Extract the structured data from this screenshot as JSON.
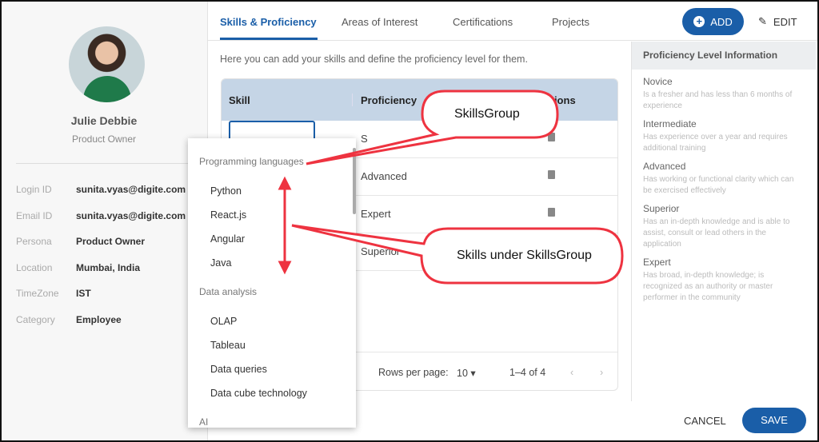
{
  "profile": {
    "name": "Julie Debbie",
    "role": "Product Owner",
    "info": [
      {
        "label": "Login ID",
        "value": "sunita.vyas@digite.com"
      },
      {
        "label": "Email ID",
        "value": "sunita.vyas@digite.com"
      },
      {
        "label": "Persona",
        "value": "Product Owner"
      },
      {
        "label": "Location",
        "value": "Mumbai, India"
      },
      {
        "label": "TimeZone",
        "value": "IST"
      },
      {
        "label": "Category",
        "value": "Employee"
      }
    ]
  },
  "tabs": [
    "Skills & Proficiency",
    "Areas of Interest",
    "Certifications",
    "Projects"
  ],
  "toolbar": {
    "add": "ADD",
    "edit": "EDIT"
  },
  "intro": "Here you can add your skills and define the proficiency level for them.",
  "table": {
    "headers": [
      "Skill",
      "Proficiency",
      "Actions"
    ],
    "rows": [
      {
        "proficiency": "S"
      },
      {
        "proficiency": "Advanced"
      },
      {
        "proficiency": "Expert"
      },
      {
        "proficiency": "Superior"
      }
    ],
    "footer": {
      "rows_label": "Rows per page:",
      "rows_value": "10",
      "range": "1–4 of 4"
    }
  },
  "dropdown": {
    "groups": [
      {
        "name": "Programming languages",
        "items": [
          "Python",
          "React.js",
          "Angular",
          "Java"
        ]
      },
      {
        "name": "Data analysis",
        "items": [
          "OLAP",
          "Tableau",
          "Data queries",
          "Data cube technology"
        ]
      },
      {
        "name": "AI",
        "items": []
      }
    ]
  },
  "info_panel": {
    "title": "Proficiency Level Information",
    "levels": [
      {
        "name": "Novice",
        "desc": "Is a fresher and has less than 6 months of experience"
      },
      {
        "name": "Intermediate",
        "desc": "Has experience over a year and requires additional training"
      },
      {
        "name": "Advanced",
        "desc": "Has working or functional clarity which can be exercised effectively"
      },
      {
        "name": "Superior",
        "desc": "Has an in-depth knowledge and is able to assist, consult or lead others in the application"
      },
      {
        "name": "Expert",
        "desc": "Has broad, in-depth knowledge; is recognized as an authority or master performer in the community"
      }
    ]
  },
  "footer": {
    "cancel": "CANCEL",
    "save": "SAVE"
  },
  "callouts": {
    "group": "SkillsGroup",
    "skills": "Skills under SkillsGroup"
  },
  "colors": {
    "accent": "#1a5ea8",
    "callout": "#ee3340",
    "table_header": "#c5d5e6"
  }
}
